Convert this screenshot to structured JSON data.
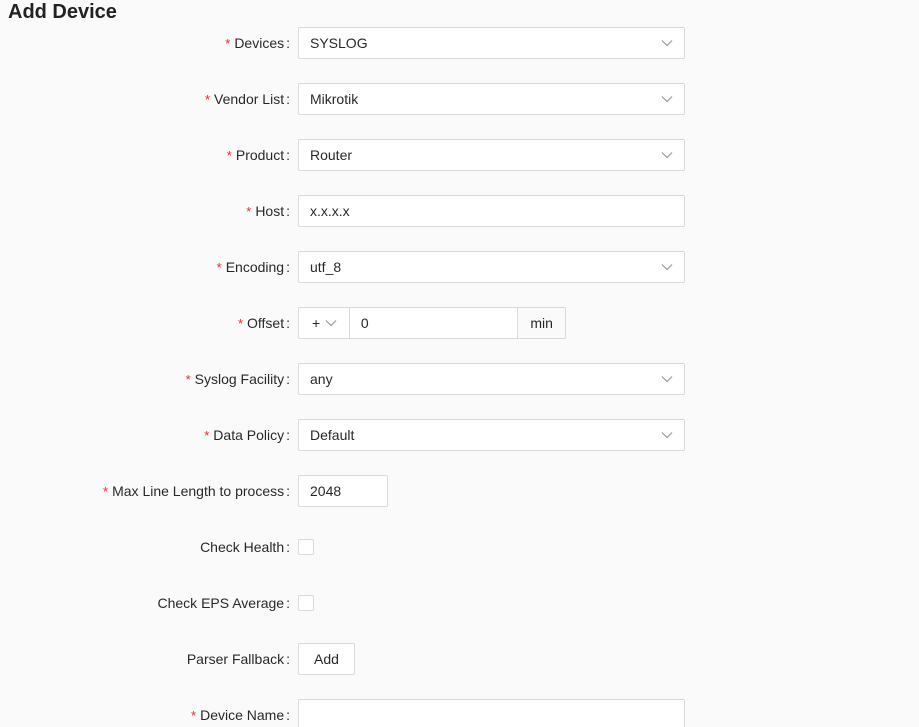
{
  "page": {
    "title": "Add Device"
  },
  "colors": {
    "required": "#f5222d",
    "border": "#d9d9d9"
  },
  "form": {
    "devices": {
      "label": "Devices",
      "value": "SYSLOG"
    },
    "vendor": {
      "label": "Vendor List",
      "value": "Mikrotik"
    },
    "product": {
      "label": "Product",
      "value": "Router"
    },
    "host": {
      "label": "Host",
      "value": "x.x.x.x"
    },
    "encoding": {
      "label": "Encoding",
      "value": "utf_8"
    },
    "offset": {
      "label": "Offset",
      "sign": "+",
      "value": "0",
      "unit": "min"
    },
    "syslog_facility": {
      "label": "Syslog Facility",
      "value": "any"
    },
    "data_policy": {
      "label": "Data Policy",
      "value": "Default"
    },
    "max_line_length": {
      "label": "Max Line Length to process",
      "value": "2048"
    },
    "check_health": {
      "label": "Check Health",
      "checked": false
    },
    "check_eps": {
      "label": "Check EPS Average",
      "checked": false
    },
    "parser_fallback": {
      "label": "Parser Fallback",
      "button_label": "Add"
    },
    "device_name": {
      "label": "Device Name",
      "value": ""
    }
  },
  "icons": {
    "select_arrow": "chevron-down-icon"
  }
}
